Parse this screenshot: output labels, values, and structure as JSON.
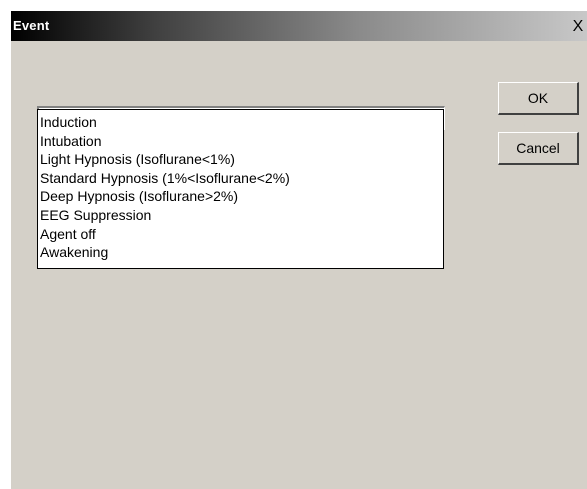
{
  "window": {
    "title": "Event",
    "close_label": "X"
  },
  "event_select": {
    "value": "",
    "options": [
      "Induction",
      "Intubation",
      "Light Hypnosis (Isoflurane<1%)",
      "Standard Hypnosis (1%<Isoflurane<2%)",
      "Deep Hypnosis (Isoflurane>2%)",
      "EEG Suppression",
      "Agent off",
      "Awakening"
    ]
  },
  "buttons": {
    "ok_label": "OK",
    "cancel_label": "Cancel"
  },
  "colors": {
    "dialog_face": "#d4d0c8",
    "titlebar_start": "#000000",
    "titlebar_end": "#c8c8c8"
  }
}
